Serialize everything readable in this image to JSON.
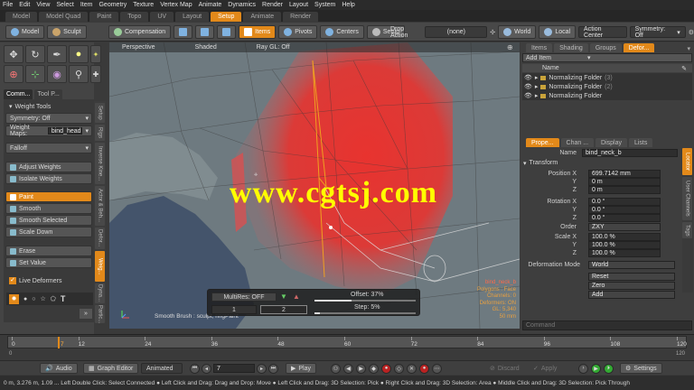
{
  "menubar": [
    "File",
    "Edit",
    "View",
    "Select",
    "Item",
    "Geometry",
    "Texture",
    "Vertex Map",
    "Animate",
    "Dynamics",
    "Render",
    "Layout",
    "System",
    "Help"
  ],
  "layout_tabs": [
    {
      "label": "Model",
      "active": false
    },
    {
      "label": "Model Quad",
      "active": false
    },
    {
      "label": "Paint",
      "active": false
    },
    {
      "label": "Topo",
      "active": false
    },
    {
      "label": "UV",
      "active": false
    },
    {
      "label": "Layout",
      "active": false
    },
    {
      "label": "Setup",
      "active": true
    },
    {
      "label": "Animate",
      "active": false
    },
    {
      "label": "Render",
      "active": false
    }
  ],
  "toolbar": {
    "model": "Model",
    "sculpt": "Sculpt",
    "compensation": "Compensation",
    "items": "Items",
    "pivots": "Pivots",
    "centers": "Centers",
    "setup": "Setup",
    "drop_action_label": "Drop Action",
    "drop_action_value": "(none)",
    "world": "World",
    "local": "Local",
    "action_center": "Action Center",
    "symmetry": "Symmetry: Off"
  },
  "left_panel": {
    "tabs": [
      "Comm...",
      "Tool P..."
    ],
    "section_title": "Weight Tools",
    "symmetry": "Symmetry: Off",
    "weight_maps_label": "Weight Maps:",
    "weight_maps_value": "bind_head",
    "falloff": "Falloff",
    "buttons": [
      {
        "label": "Adjust Weights",
        "active": false
      },
      {
        "label": "Isolate Weights",
        "active": false
      },
      {
        "label": "Paint",
        "active": true
      },
      {
        "label": "Smooth",
        "active": false
      },
      {
        "label": "Smooth Selected",
        "active": false
      },
      {
        "label": "Scale Down",
        "active": false
      },
      {
        "label": "Erase",
        "active": false
      },
      {
        "label": "Set Value",
        "active": false
      }
    ],
    "live_deformers": "Live Deformers",
    "vertical_tabs": [
      "Setup",
      "Rigs",
      "Inverse Kine...",
      "Actor & Beh...",
      "Defor...",
      "Weig...",
      "Dyna...",
      "Partic..."
    ]
  },
  "viewport": {
    "tabs": [
      "Perspective",
      "Shaded",
      "Ray GL: Off"
    ],
    "watermark": "www.cgtsj.com",
    "info_lines": [
      "bind_neck_b",
      "Polygons : Face",
      "Channels: 0",
      "Deformers: ON",
      "GL: 5,340",
      "50 mm"
    ],
    "brush_label": "Smooth Brush : sculpt, ringPaint",
    "hud": {
      "multires": "MultiRes: OFF",
      "level_a": "1",
      "level_b": "2",
      "offset_label": "Offset:",
      "offset_value": "37%",
      "offset_fraction": 0.37,
      "step_label": "Step:",
      "step_value": "5%",
      "step_fraction": 0.05
    }
  },
  "items_panel": {
    "tabs": [
      {
        "label": "Items",
        "active": false
      },
      {
        "label": "Shading",
        "active": false
      },
      {
        "label": "Groups",
        "active": false
      },
      {
        "label": "Defor...",
        "active": true
      }
    ],
    "add_item": "Add Item",
    "column_header": "Name",
    "rows": [
      {
        "name": "Normalizing Folder",
        "count": "(3)"
      },
      {
        "name": "Normalizing Folder",
        "count": "(2)"
      },
      {
        "name": "Normalizing Folder",
        "count": ""
      }
    ]
  },
  "properties_panel": {
    "tabs": [
      {
        "label": "Prope...",
        "active": true
      },
      {
        "label": "Chan ...",
        "active": false
      },
      {
        "label": "Display",
        "active": false
      },
      {
        "label": "Lists",
        "active": false
      }
    ],
    "name_label": "Name",
    "name_value": "bind_neck_b",
    "transform_title": "Transform",
    "position_label": "Position X",
    "position": [
      "699.7142 mm",
      "0 m",
      "0 m"
    ],
    "rotation_label": "Rotation X",
    "rotation": [
      "0.0 °",
      "0.0 °",
      "0.0 °"
    ],
    "order_label": "Order",
    "order_value": "ZXY",
    "scale_label": "Scale X",
    "scale": [
      "100.0 %",
      "100.0 %",
      "100.0 %"
    ],
    "y_label": "Y",
    "z_label": "Z",
    "deformation_mode_label": "Deformation Mode",
    "deformation_mode_value": "World",
    "reset": "Reset",
    "zero": "Zero",
    "add": "Add",
    "side_tabs": [
      "Locator",
      "User Channels",
      "Tags"
    ],
    "command_placeholder": "Command"
  },
  "timeline": {
    "ticks": [
      "0",
      "12",
      "24",
      "36",
      "48",
      "60",
      "72",
      "84",
      "96",
      "108",
      "120"
    ],
    "current": "7",
    "end_labels": [
      "0",
      "120"
    ]
  },
  "bottom_bar": {
    "audio": "Audio",
    "graph_editor": "Graph Editor",
    "animated": "Animated",
    "frame": "7",
    "play": "Play",
    "discard": "Discard",
    "apply": "Apply",
    "settings": "Settings"
  },
  "status_bar": "0 m, 3.276 m, 1.09 ...   Left Double Click: Select Connected ● Left Click and Drag: Drag and Drop: Move ● Left Click and Drag: 3D Selection: Pick ● Right Click and Drag: 3D Selection: Area ● Middle Click and Drag: 3D Selection: Pick Through",
  "colors": {
    "accent": "#e2891a",
    "weight_red": "#e8332f",
    "watermark": "#ffff00",
    "viewport_bg": "#6e7a80",
    "water_blue": "#44546b",
    "info_orange": "#e8a040"
  }
}
